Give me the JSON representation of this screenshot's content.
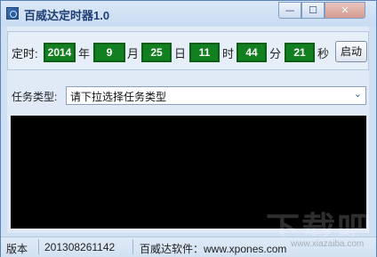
{
  "window": {
    "title": "百威达定时器1.0",
    "controls": {
      "minimize": "—",
      "maximize": "☐",
      "close": "✕"
    }
  },
  "timer": {
    "label": "定时:",
    "year": "2014",
    "year_unit": "年",
    "month": "9",
    "month_unit": "月",
    "day": "25",
    "day_unit": "日",
    "hour": "11",
    "hour_unit": "时",
    "minute": "44",
    "minute_unit": "分",
    "second": "21",
    "second_unit": "秒",
    "start_label": "启动"
  },
  "task": {
    "label": "任务类型:",
    "selected": "请下拉选择任务类型"
  },
  "statusbar": {
    "version_label": "版本",
    "version": "201308261142",
    "company": "百威达软件：www.xpones.com"
  },
  "watermark": {
    "text": "下载吧",
    "sub": "www.xiazaiba.com"
  },
  "colors": {
    "digit_bg": "#127f21",
    "log_bg": "#000000",
    "title_color": "#1e3e73"
  }
}
